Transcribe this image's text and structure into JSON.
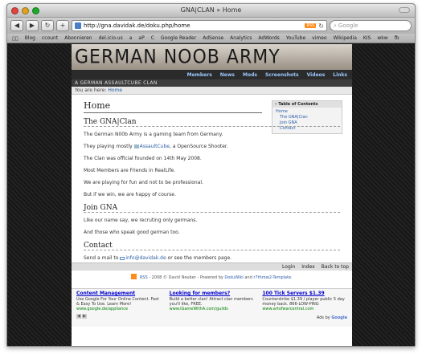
{
  "window": {
    "title": "GNA|CLAN » Home"
  },
  "toolbar": {
    "url": "http://gna.davidak.de/doku.php/home",
    "rss_label": "RSS",
    "search_placeholder": "Google"
  },
  "bookmarks": [
    "Blog",
    "ccount",
    "Abonnieren",
    "del.icio.us",
    "a",
    "aP",
    "C",
    "Google Reader",
    "AdSense",
    "Analytics",
    "AdWords",
    "YouTube",
    "vimeo",
    "Wikipedia",
    "KIS",
    "wkw",
    "fb"
  ],
  "site": {
    "banner_title": "GERMAN NOOB ARMY",
    "subtitle": "A GERMAN ASSAULTCUBE CLAN",
    "nav": [
      "Members",
      "News",
      "Mods",
      "Screenshots",
      "Videos",
      "Links"
    ],
    "breadcrumb_prefix": "You are here:",
    "breadcrumb_link": "Home"
  },
  "toc": {
    "title": "Table of Contents",
    "items": [
      {
        "label": "Home",
        "sub": false
      },
      {
        "label": "The GNA|Clan",
        "sub": true
      },
      {
        "label": "Join GNA",
        "sub": true
      },
      {
        "label": "Contact",
        "sub": true
      }
    ]
  },
  "content": {
    "h1": "Home",
    "s1_title": "The GNA|Clan",
    "p1": "The German N00b Army is a gaming team from Germany.",
    "p2_pre": "They playing mostly",
    "p2_link": "AssaultCube",
    "p2_post": ", a OpenSource Shooter.",
    "p3": "The Clan was official founded on 14th May 2008.",
    "p4": "Most Members are Friends in RealLife.",
    "p5": "We are playing for fun and not to be professional.",
    "p6": "But if we win, we are happy of course.",
    "s2_title": "Join GNA",
    "p7": "Like our name say, we recruting only germans.",
    "p8": "And those who speak good german too.",
    "s3_title": "Contact",
    "p9_pre": "Send a mail to",
    "p9_link": "info@davidak.de",
    "p9_post": "or see the members page."
  },
  "footer": {
    "links": [
      "Login",
      "Index",
      "Back to top"
    ],
    "credit_rss": "RSS",
    "credit_text1": "- 2008 © David Neuber - Powered by",
    "credit_link1": "DokuWiki",
    "credit_text2": "and",
    "credit_link2": "r7throw2-Template."
  },
  "ads": [
    {
      "title": "Content Management",
      "text": "Use Google For Your Online Content. Fast & Easy To Use. Learn More!",
      "url": "www.google.de/appliance"
    },
    {
      "title": "Looking for members?",
      "text": "Build a better clan! Attract clan members you'll like, FREE.",
      "url": "www.iGameWithA.com/guilds"
    },
    {
      "title": "100 Tick Servers $1.39",
      "text": "Counterstrike $1.39 / player public 5 day money back. 866-LOW-PING",
      "url": "www.artofwarcentral.com"
    }
  ],
  "ads_by": {
    "prefix": "Ads by",
    "brand": "Google"
  }
}
